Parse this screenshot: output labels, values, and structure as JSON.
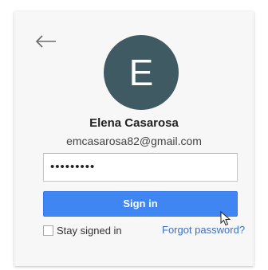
{
  "account": {
    "avatar_letter": "E",
    "name": "Elena Casarosa",
    "email": "emcasarosa82@gmail.com"
  },
  "form": {
    "password_value": "•••••••••",
    "signin_label": "Sign in",
    "stay_signed_in_label": "Stay signed in",
    "stay_signed_in_checked": false,
    "forgot_password_label": "Forgot password?"
  },
  "icons": {
    "back": "back-arrow-icon",
    "cursor": "mouse-pointer-icon"
  },
  "colors": {
    "avatar_bg": "#3f5a63",
    "primary_button": "#3f86f3",
    "link": "#3f6fc4"
  }
}
